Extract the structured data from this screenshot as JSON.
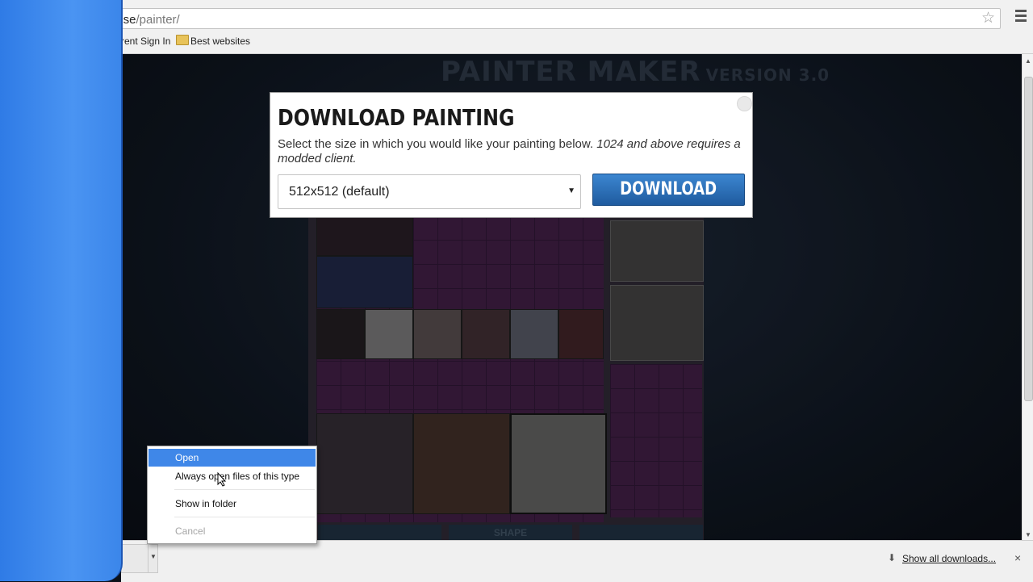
{
  "browser": {
    "url_host": "k.se",
    "url_path": "/painter/",
    "bookmarks": [
      {
        "label": "rent Sign In"
      },
      {
        "label": "Best websites"
      }
    ]
  },
  "site": {
    "title": "PAINTER MAKER",
    "version": "VERSION 3.0",
    "bottom_tab_label": "SHAPE"
  },
  "dialog": {
    "title": "DOWNLOAD PAINTING",
    "description": "Select the size in which you would like your painting below.",
    "description_note": "1024 and above requires a modded client.",
    "size_value": "512x512 (default)",
    "download_label": "DOWNLOAD"
  },
  "context_menu": {
    "items": [
      {
        "label": "Open"
      },
      {
        "label": "Always open files of this type"
      },
      {
        "label": "Show in folder"
      },
      {
        "label": "Cancel"
      }
    ]
  },
  "download_bar": {
    "show_all_label": "Show all downloads...",
    "close_symbol": "×"
  },
  "icons": {
    "star": "star-icon",
    "menu": "menu-icon",
    "folder": "folder-icon",
    "download": "download-icon",
    "close": "close-icon"
  },
  "colors": {
    "accent_blue": "#3f87e8",
    "download_button": "#2566ad",
    "left_panel": "#3b86ea"
  }
}
